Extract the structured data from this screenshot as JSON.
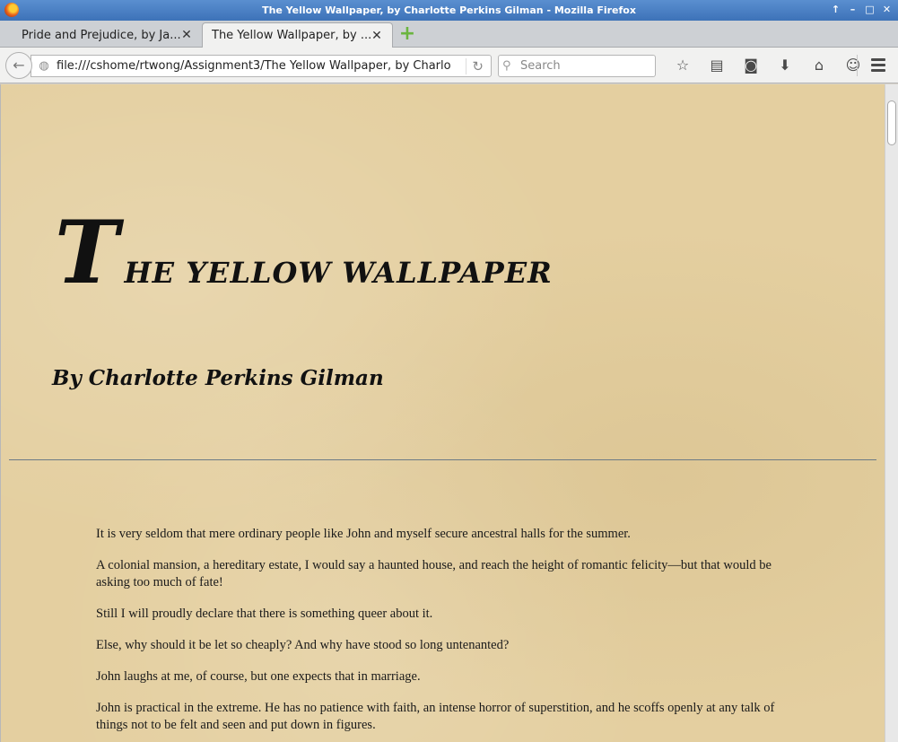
{
  "window": {
    "title": "The Yellow Wallpaper, by Charlotte Perkins Gilman - Mozilla Firefox",
    "controls": [
      "↑",
      "–",
      "□",
      "✕"
    ]
  },
  "tabs": [
    {
      "label": "Pride and Prejudice, by Ja...",
      "close": "✕",
      "active": false
    },
    {
      "label": "The Yellow Wallpaper, by ...",
      "close": "✕",
      "active": true
    }
  ],
  "newtab": {
    "label": "+"
  },
  "navbar": {
    "back": "←",
    "url": "file:///cshome/rtwong/Assignment3/The Yellow Wallpaper, by Charlot",
    "reload": "↻",
    "search_placeholder": "Search",
    "icons": [
      {
        "name": "bookmark-star-icon",
        "glyph": "☆"
      },
      {
        "name": "reading-list-icon",
        "glyph": "▤"
      },
      {
        "name": "pocket-icon",
        "glyph": "◙"
      },
      {
        "name": "download-icon",
        "glyph": "⬇"
      },
      {
        "name": "home-icon",
        "glyph": "⌂"
      },
      {
        "name": "hello-chat-icon",
        "glyph": "☺"
      }
    ]
  },
  "page": {
    "title_dropcap": "T",
    "title_rest": "HE YELLOW WALLPAPER",
    "byline": "By Charlotte Perkins Gilman",
    "paragraphs": [
      "It is very seldom that mere ordinary people like John and myself secure ancestral halls for the summer.",
      "A colonial mansion, a hereditary estate, I would say a haunted house, and reach the height of romantic felicity—but that would be asking too much of fate!",
      "Still I will proudly declare that there is something queer about it.",
      "Else, why should it be let so cheaply? And why have stood so long untenanted?",
      "John laughs at me, of course, but one expects that in marriage.",
      "John is practical in the extreme. He has no patience with faith, an intense horror of superstition, and he scoffs openly at any talk of things not to be felt and seen and put down in figures."
    ]
  },
  "colors": {
    "titlebar": "#3d72b8",
    "page_background": "#e4cfa0",
    "divider": "#6b7a86"
  }
}
